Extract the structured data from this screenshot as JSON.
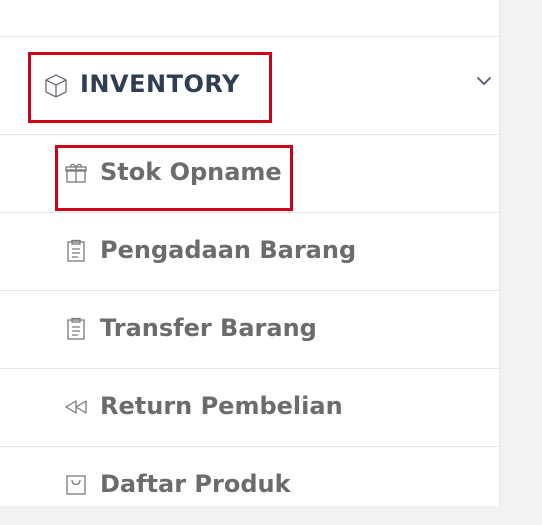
{
  "inventory_group": {
    "title": "INVENTORY",
    "icon": "box-icon",
    "expanded": true
  },
  "menu_items": [
    {
      "label": "Stok Opname",
      "icon": "gift-icon",
      "highlighted": true
    },
    {
      "label": "Pengadaan Barang",
      "icon": "clipboard-icon",
      "highlighted": false
    },
    {
      "label": "Transfer Barang",
      "icon": "clipboard-icon",
      "highlighted": false
    },
    {
      "label": "Return Pembelian",
      "icon": "rewind-icon",
      "highlighted": false
    },
    {
      "label": "Daftar Produk",
      "icon": "bag-icon",
      "highlighted": false
    }
  ],
  "colors": {
    "highlight": "#d0021b",
    "group_title": "#2f3e55",
    "item_text": "#6c6c6c",
    "divider": "#e3e5e8"
  }
}
